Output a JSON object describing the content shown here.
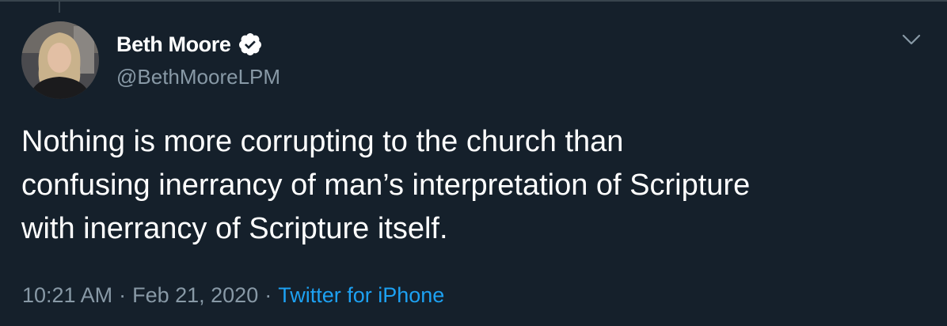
{
  "tweet": {
    "author": {
      "display_name": "Beth Moore",
      "handle": "@BethMooreLPM",
      "verified": true,
      "avatar_icon": "profile-photo"
    },
    "text": "Nothing is more corrupting to the church than\nconfusing inerrancy of man’s interpretation of Scripture\nwith inerrancy of Scripture itself.",
    "time": "10:21 AM",
    "date": "Feb 21, 2020",
    "separator": "·",
    "source": "Twitter for iPhone",
    "menu_icon": "chevron-down-icon"
  },
  "colors": {
    "background": "#15202b",
    "primary_text": "#ffffff",
    "secondary_text": "#8899a6",
    "link": "#1da1f2",
    "border": "#38444d"
  }
}
